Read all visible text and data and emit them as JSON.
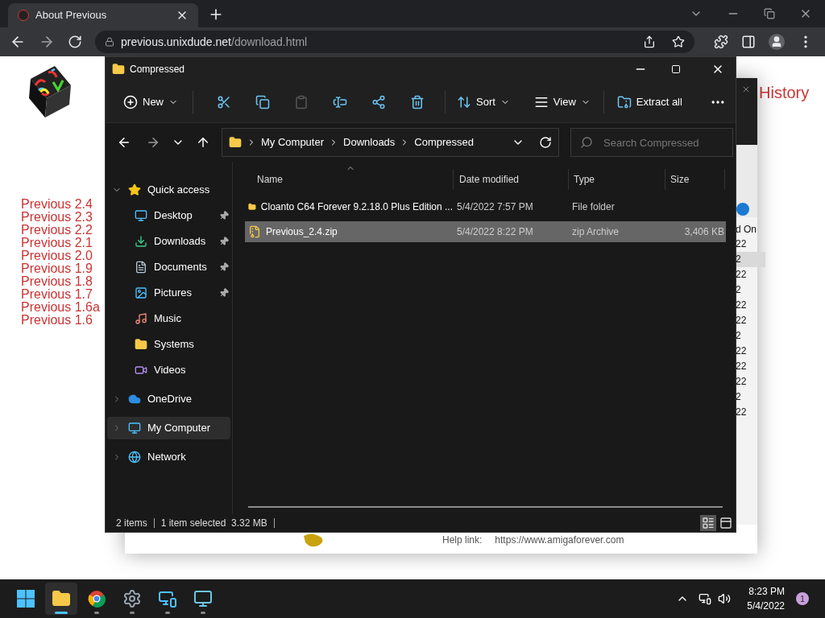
{
  "browser": {
    "tab_title": "About Previous",
    "url_host": "previous.unixdude.net",
    "url_path": "/download.html"
  },
  "page": {
    "versions": [
      "Previous 2.4",
      "Previous 2.3",
      "Previous 2.2",
      "Previous 2.1",
      "Previous 2.0",
      "Previous 1.9",
      "Previous 1.8",
      "Previous 1.7",
      "Previous 1.6a",
      "Previous 1.6"
    ],
    "history_link": "History"
  },
  "background_window": {
    "column_header": "d On",
    "cells": [
      {
        "text": "22",
        "selected": false
      },
      {
        "text": "2",
        "selected": true
      },
      {
        "text": "22",
        "selected": false
      },
      {
        "text": "2",
        "selected": false
      },
      {
        "text": "22",
        "selected": false
      },
      {
        "text": "22",
        "selected": false
      },
      {
        "text": "2",
        "selected": false
      },
      {
        "text": "22",
        "selected": false
      },
      {
        "text": "22",
        "selected": false
      },
      {
        "text": "22",
        "selected": false
      },
      {
        "text": "2",
        "selected": false
      },
      {
        "text": "22",
        "selected": false
      }
    ],
    "help_label": "Help link:",
    "help_url": "https://www.amigaforever.com"
  },
  "explorer": {
    "title": "Compressed",
    "toolbar": {
      "new": "New",
      "icon_buttons": [
        {
          "disabled": false
        },
        {
          "disabled": false
        },
        {
          "disabled": true
        },
        {
          "disabled": false
        },
        {
          "disabled": false
        },
        {
          "disabled": false
        }
      ],
      "sort": "Sort",
      "view": "View",
      "extract": "Extract all"
    },
    "breadcrumb": [
      "My Computer",
      "Downloads",
      "Compressed"
    ],
    "search": {
      "placeholder": "Search Compressed"
    },
    "columns": [
      "Name",
      "Date modified",
      "Type",
      "Size"
    ],
    "rows": [
      {
        "kind": "folder",
        "name": "Cloanto C64 Forever 9.2.18.0 Plus Edition ...",
        "date": "5/4/2022 7:57 PM",
        "type": "File folder",
        "size": "",
        "selected": false
      },
      {
        "kind": "zip",
        "name": "Previous_2.4.zip",
        "date": "5/4/2022 8:22 PM",
        "type": "zip Archive",
        "size": "3,406 KB",
        "selected": true
      }
    ],
    "nav": [
      {
        "label": "Quick access",
        "expanded": true,
        "selected": false,
        "children": [
          {
            "label": "Desktop",
            "pinned": true
          },
          {
            "label": "Downloads",
            "pinned": true
          },
          {
            "label": "Documents",
            "pinned": true
          },
          {
            "label": "Pictures",
            "pinned": true
          },
          {
            "label": "Music",
            "pinned": false
          },
          {
            "label": "Systems",
            "pinned": false
          },
          {
            "label": "Videos",
            "pinned": false
          }
        ]
      },
      {
        "label": "OneDrive",
        "expanded": false,
        "selected": false
      },
      {
        "label": "My Computer",
        "expanded": false,
        "selected": true
      },
      {
        "label": "Network",
        "expanded": false,
        "selected": false
      }
    ],
    "status": {
      "items": "2 items",
      "selection": "1 item selected  3.32 MB"
    },
    "views": [
      {
        "selected": true
      },
      {
        "selected": false
      }
    ]
  },
  "taskbar": {
    "apps": [
      {
        "active": true
      },
      {
        "active": false
      },
      {
        "active": false
      },
      {
        "active": false
      },
      {
        "active": false
      }
    ],
    "time": "8:23 PM",
    "date": "5/4/2022",
    "notifications": "1"
  }
}
